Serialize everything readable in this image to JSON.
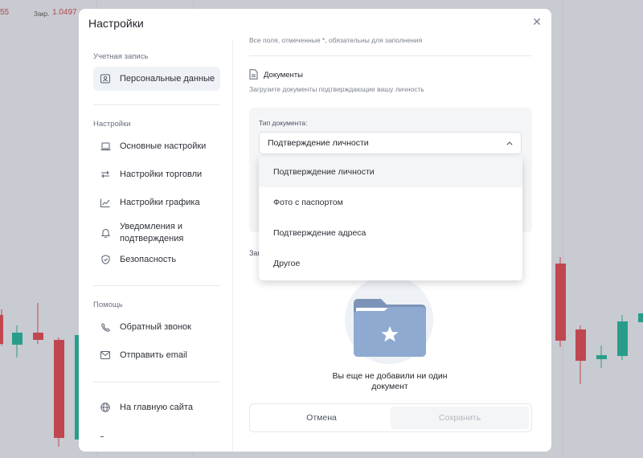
{
  "background": {
    "left_value": "55",
    "close_label": "Закр.",
    "close_value": "1.0497"
  },
  "modal": {
    "title": "Настройки",
    "close_icon": "close-icon"
  },
  "sidebar": {
    "account_section": "Учетная запись",
    "personal_data": "Персональные данные",
    "settings_section": "Настройки",
    "items": [
      {
        "label": "Основные настройки",
        "icon": "laptop-icon"
      },
      {
        "label": "Настройки торговли",
        "icon": "transfer-icon"
      },
      {
        "label": "Настройки графика",
        "icon": "chart-icon"
      },
      {
        "label": "Уведомления и подтверждения",
        "icon": "bell-icon"
      },
      {
        "label": "Безопасность",
        "icon": "shield-icon"
      }
    ],
    "help_section": "Помощь",
    "help_items": [
      {
        "label": "Обратный звонок",
        "icon": "phone-icon"
      },
      {
        "label": "Отправить email",
        "icon": "mail-icon"
      }
    ],
    "home_link": "На главную сайта"
  },
  "content": {
    "required_note": "Все поля, отмеченные *, обязательны для заполнения",
    "documents_title": "Документы",
    "documents_subtitle": "Загрузите документы подтверждающие вашу личность",
    "doc_type_label": "Тип документа:",
    "doc_type_value": "Подтверждение личности",
    "upload_label_partial": "Заг",
    "empty_text": "Вы еще не добавили ни один документ",
    "cancel": "Отмена",
    "save": "Сохранить"
  },
  "dropdown": {
    "options": [
      "Подтверждение личности",
      "Фото с паспортом",
      "Подтверждение адреса",
      "Другое"
    ],
    "selected": "Подтверждение личности"
  },
  "colors": {
    "bull": "#2a9d8a",
    "bear": "#c0474f"
  }
}
